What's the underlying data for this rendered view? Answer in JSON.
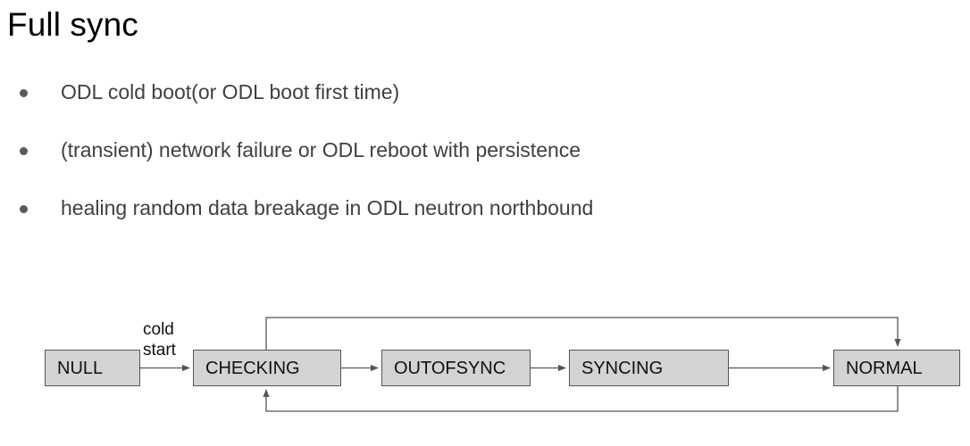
{
  "slide": {
    "title": "Full sync",
    "bullets": [
      {
        "marker": "bullet-dot",
        "text": "ODL cold boot(or ODL boot first time)"
      },
      {
        "marker": "bullet-dot",
        "text": "(transient) network failure or ODL reboot with persistence"
      },
      {
        "marker": "bullet-dot",
        "text": "healing random data breakage in ODL neutron northbound"
      }
    ]
  },
  "diagram": {
    "type": "state-machine",
    "states": [
      {
        "id": "null",
        "label": "NULL"
      },
      {
        "id": "checking",
        "label": "CHECKING"
      },
      {
        "id": "outofsync",
        "label": "OUTOFSYNC"
      },
      {
        "id": "syncing",
        "label": "SYNCING"
      },
      {
        "id": "normal",
        "label": "NORMAL"
      }
    ],
    "transitions": [
      {
        "from": "null",
        "to": "checking",
        "label_line1": "cold",
        "label_line2": "start"
      },
      {
        "from": "checking",
        "to": "outofsync",
        "label_line1": "",
        "label_line2": ""
      },
      {
        "from": "outofsync",
        "to": "syncing",
        "label_line1": "",
        "label_line2": ""
      },
      {
        "from": "syncing",
        "to": "normal",
        "label_line1": "",
        "label_line2": ""
      },
      {
        "from": "checking",
        "to": "normal",
        "label_line1": "",
        "label_line2": ""
      },
      {
        "from": "normal",
        "to": "checking",
        "label_line1": "",
        "label_line2": ""
      }
    ],
    "edge_label_coldstart": "cold\nstart",
    "colors": {
      "box_fill": "#d3d3d3",
      "box_border": "#555555",
      "edge": "#555555",
      "text": "#111111"
    }
  }
}
